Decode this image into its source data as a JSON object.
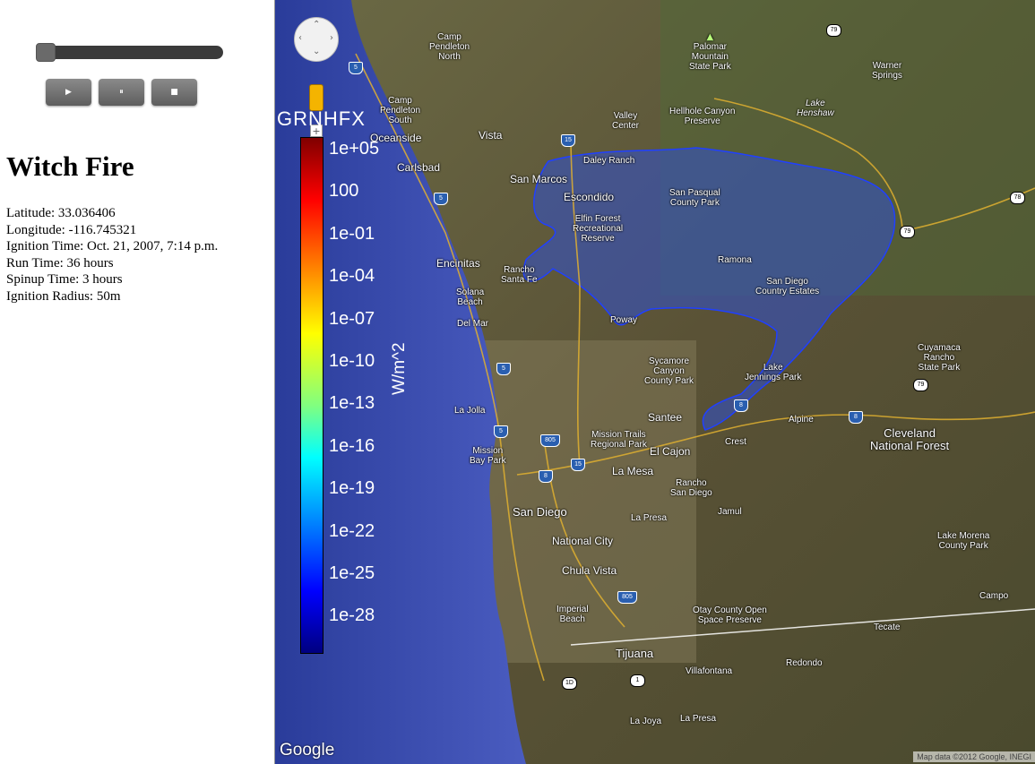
{
  "controls": {
    "play_icon": "▶",
    "pause_icon": "⏸",
    "stop_icon": "■",
    "slider_value": 0
  },
  "fire": {
    "title": "Witch Fire",
    "latitude": "Latitude: 33.036406",
    "longitude": "Longitude: -116.745321",
    "ignition_time": "Ignition Time: Oct. 21, 2007, 7:14 p.m.",
    "run_time": "Run Time: 36 hours",
    "spinup_time": "Spinup Time: 3 hours",
    "ignition_radius": "Ignition Radius: 50m"
  },
  "colorbar": {
    "title": "GRNHFX",
    "unit": "W/m^2",
    "ticks": [
      "1e+05",
      "100",
      "1e-01",
      "1e-04",
      "1e-07",
      "1e-10",
      "1e-13",
      "1e-16",
      "1e-19",
      "1e-22",
      "1e-25",
      "1e-28"
    ]
  },
  "map": {
    "google_logo": "Google",
    "attribution": "Map data ©2012 Google, INEGI",
    "places": {
      "camp_pendleton_north": "Camp\nPendleton\nNorth",
      "camp_pendleton_south": "Camp\nPendleton\nSouth",
      "palomar": "Palomar\nMountain\nState Park",
      "warner_springs": "Warner\nSprings",
      "lake_henshaw": "Lake\nHenshaw",
      "hellhole": "Hellhole Canyon\nPreserve",
      "valley_center": "Valley\nCenter",
      "oceanside": "Oceanside",
      "vista": "Vista",
      "carlsbad": "Carlsbad",
      "daley_ranch": "Daley Ranch",
      "san_marcos": "San Marcos",
      "escondido": "Escondido",
      "san_pasqual": "San Pasqual\nCounty Park",
      "elfin_forest": "Elfin Forest\nRecreational\nReserve",
      "encinitas": "Encinitas",
      "rancho_santa_fe": "Rancho\nSanta Fe",
      "ramona": "Ramona",
      "sd_country_estates": "San Diego\nCountry Estates",
      "solana_beach": "Solana\nBeach",
      "del_mar": "Del Mar",
      "poway": "Poway",
      "cuyamaca": "Cuyamaca\nRancho\nState Park",
      "sycamore": "Sycamore\nCanyon\nCounty Park",
      "lake_jennings": "Lake\nJennings Park",
      "la_jolla": "La Jolla",
      "santee": "Santee",
      "alpine": "Alpine",
      "cleveland": "Cleveland\nNational Forest",
      "mission_trails": "Mission Trails\nRegional Park",
      "crest": "Crest",
      "el_cajon": "El Cajon",
      "mission_bay": "Mission\nBay Park",
      "la_mesa": "La Mesa",
      "rancho_san_diego": "Rancho\nSan Diego",
      "san_diego": "San Diego",
      "jamul": "Jamul",
      "la_presa": "La Presa",
      "national_city": "National City",
      "lake_morena": "Lake Morena\nCounty Park",
      "chula_vista": "Chula Vista",
      "campo": "Campo",
      "imperial_beach": "Imperial\nBeach",
      "otay": "Otay County Open\nSpace Preserve",
      "tecate": "Tecate",
      "tijuana": "Tijuana",
      "villafontana": "Villafontana",
      "redondo": "Redondo",
      "la_joya": "La Joya",
      "la_presa_mx": "La Presa"
    },
    "shields": {
      "i5_a": "5",
      "i5_b": "5",
      "i5_c": "5",
      "i5_d": "5",
      "i15_a": "15",
      "i15_b": "15",
      "i8_a": "8",
      "i8_b": "8",
      "i8_c": "8",
      "i805_a": "805",
      "i805_b": "805",
      "sr79_a": "79",
      "sr79_b": "79",
      "sr79_c": "79",
      "sr78": "78",
      "sr1": "1",
      "sr1d": "1D"
    }
  }
}
